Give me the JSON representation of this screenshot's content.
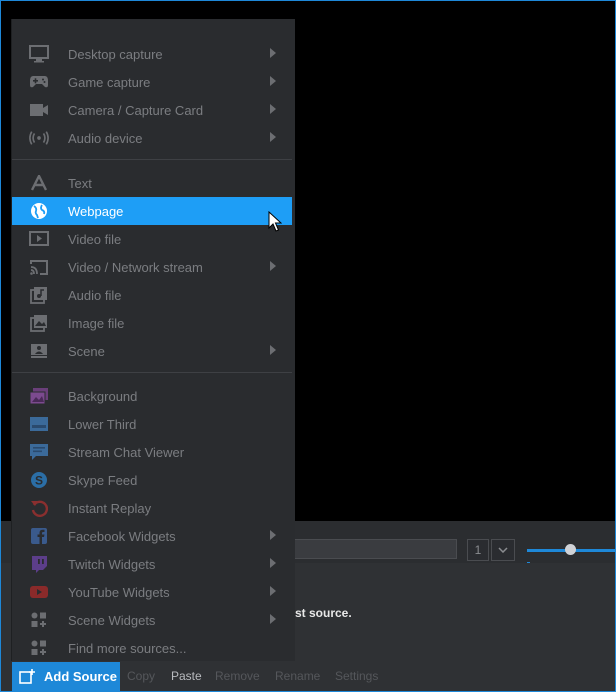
{
  "menu": {
    "groups": [
      [
        {
          "label": "Desktop capture",
          "icon": "monitor-icon",
          "submenu": true
        },
        {
          "label": "Game capture",
          "icon": "gamepad-icon",
          "submenu": true
        },
        {
          "label": "Camera / Capture Card",
          "icon": "camera-icon",
          "submenu": true
        },
        {
          "label": "Audio device",
          "icon": "audio-device-icon",
          "submenu": true
        }
      ],
      [
        {
          "label": "Text",
          "icon": "text-icon",
          "submenu": false
        },
        {
          "label": "Webpage",
          "icon": "globe-icon",
          "submenu": false,
          "highlighted": true
        },
        {
          "label": "Video file",
          "icon": "video-file-icon",
          "submenu": false
        },
        {
          "label": "Video / Network stream",
          "icon": "cast-icon",
          "submenu": true
        },
        {
          "label": "Audio file",
          "icon": "audio-file-icon",
          "submenu": false
        },
        {
          "label": "Image file",
          "icon": "image-file-icon",
          "submenu": false
        },
        {
          "label": "Scene",
          "icon": "scene-icon",
          "submenu": true
        }
      ],
      [
        {
          "label": "Background",
          "icon": "background-icon",
          "submenu": false
        },
        {
          "label": "Lower Third",
          "icon": "lower-third-icon",
          "submenu": false
        },
        {
          "label": "Stream Chat Viewer",
          "icon": "chat-icon",
          "submenu": false
        },
        {
          "label": "Skype Feed",
          "icon": "skype-icon",
          "submenu": false
        },
        {
          "label": "Instant Replay",
          "icon": "replay-icon",
          "submenu": false
        },
        {
          "label": "Facebook Widgets",
          "icon": "facebook-icon",
          "submenu": true
        },
        {
          "label": "Twitch Widgets",
          "icon": "twitch-icon",
          "submenu": true
        },
        {
          "label": "YouTube Widgets",
          "icon": "youtube-icon",
          "submenu": true
        },
        {
          "label": "Scene Widgets",
          "icon": "scene-widgets-icon",
          "submenu": true
        },
        {
          "label": "Find more sources...",
          "icon": "find-sources-icon",
          "submenu": false
        }
      ]
    ]
  },
  "controls": {
    "page_number": "1"
  },
  "sources_panel": {
    "hint": "irst source."
  },
  "bottom_bar": {
    "add_source_label": "Add Source",
    "copy_label": "Copy",
    "paste_label": "Paste",
    "remove_label": "Remove",
    "rename_label": "Rename",
    "settings_label": "Settings"
  },
  "colors": {
    "accent": "#1e88d8",
    "highlight": "#1e9ef6",
    "menu_bg": "#2a2c2f",
    "text_dim": "#7b7d81"
  }
}
